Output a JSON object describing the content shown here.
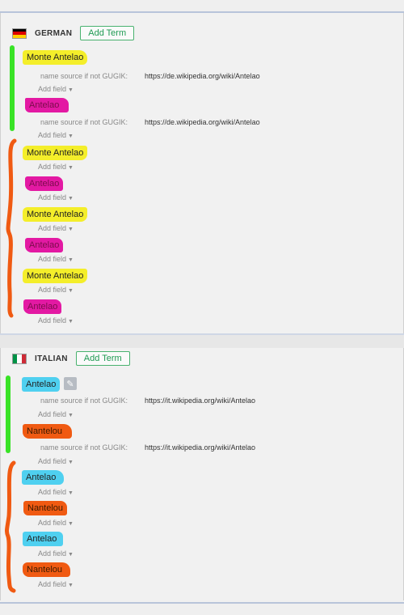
{
  "colors": {
    "yellow": "#f4ee2a",
    "pink": "#e319a3",
    "cyan": "#4fd0f0",
    "orange": "#f05a12",
    "green": "#39e326",
    "add_term_green": "#1e9a52"
  },
  "german": {
    "lang": "GERMAN",
    "add_term": "Add Term",
    "flag_icon": "germany-flag-icon",
    "terms": [
      "Monte Antelao",
      "Antelao",
      "Monte Antelao",
      "Antelao",
      "Monte Antelao",
      "Antelao",
      "Monte Antelao",
      "Antelao"
    ],
    "field_label": "name source if not GUGIK:",
    "field_value": "https://de.wikipedia.org/wiki/Antelao",
    "add_field": "Add field"
  },
  "italian": {
    "lang": "ITALIAN",
    "add_term": "Add Term",
    "flag_icon": "italy-flag-icon",
    "terms": [
      "Antelao",
      "Nantelou",
      "Antelao",
      "Nantelou",
      "Antelao",
      "Nantelou"
    ],
    "field_label": "name source if not GUGIK:",
    "field_value": "https://it.wikipedia.org/wiki/Antelao",
    "add_field": "Add field",
    "edit_icon": "pencil-icon"
  }
}
